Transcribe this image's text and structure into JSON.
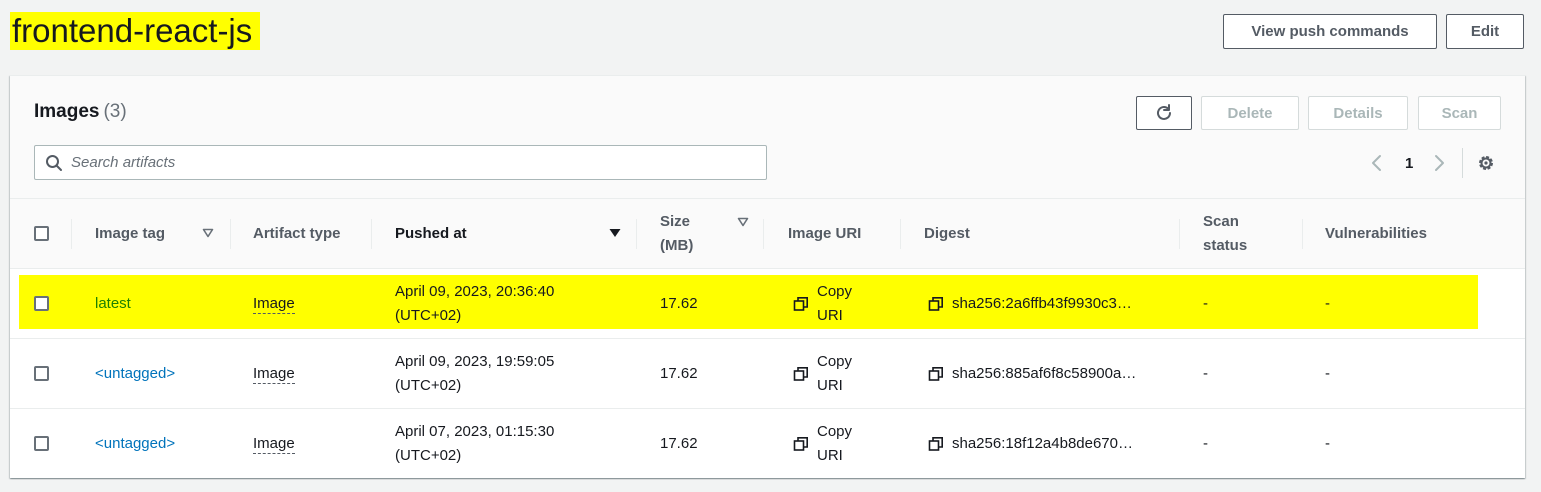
{
  "page": {
    "title": "frontend-react-js",
    "buttons": {
      "view_push_commands": "View push commands",
      "edit": "Edit"
    }
  },
  "images_panel": {
    "title": "Images",
    "count": "(3)",
    "buttons": {
      "delete": "Delete",
      "details": "Details",
      "scan": "Scan"
    },
    "search": {
      "placeholder": "Search artifacts",
      "value": ""
    },
    "pagination": {
      "current_page": "1"
    }
  },
  "table": {
    "columns": {
      "image_tag": "Image tag",
      "artifact_type": "Artifact type",
      "pushed_at": "Pushed at",
      "size_line1": "Size",
      "size_line2": "(MB)",
      "image_uri": "Image URI",
      "digest": "Digest",
      "scan_status_line1": "Scan",
      "scan_status_line2": "status",
      "vulnerabilities": "Vulnerabilities"
    },
    "rows": [
      {
        "tag": "latest",
        "artifact_type": "Image",
        "pushed_date": "April 09, 2023, 20:36:40",
        "pushed_tz": "(UTC+02)",
        "size": "17.62",
        "uri_line1": "Copy",
        "uri_line2": "URI",
        "digest": "sha256:2a6ffb43f9930c3…",
        "scan_status": "-",
        "vulnerabilities": "-"
      },
      {
        "tag": "<untagged>",
        "artifact_type": "Image",
        "pushed_date": "April 09, 2023, 19:59:05",
        "pushed_tz": "(UTC+02)",
        "size": "17.62",
        "uri_line1": "Copy",
        "uri_line2": "URI",
        "digest": "sha256:885af6f8c58900a…",
        "scan_status": "-",
        "vulnerabilities": "-"
      },
      {
        "tag": "<untagged>",
        "artifact_type": "Image",
        "pushed_date": "April 07, 2023, 01:15:30",
        "pushed_tz": "(UTC+02)",
        "size": "17.62",
        "uri_line1": "Copy",
        "uri_line2": "URI",
        "digest": "sha256:18f12a4b8de670…",
        "scan_status": "-",
        "vulnerabilities": "-"
      }
    ]
  },
  "colors": {
    "highlight": "#ffff00",
    "link": "#0073bb",
    "text": "#16191f"
  },
  "icons": [
    "refresh-icon",
    "search-icon",
    "chevron-left-icon",
    "chevron-right-icon",
    "gear-icon",
    "sort-down-icon",
    "copy-icon"
  ]
}
